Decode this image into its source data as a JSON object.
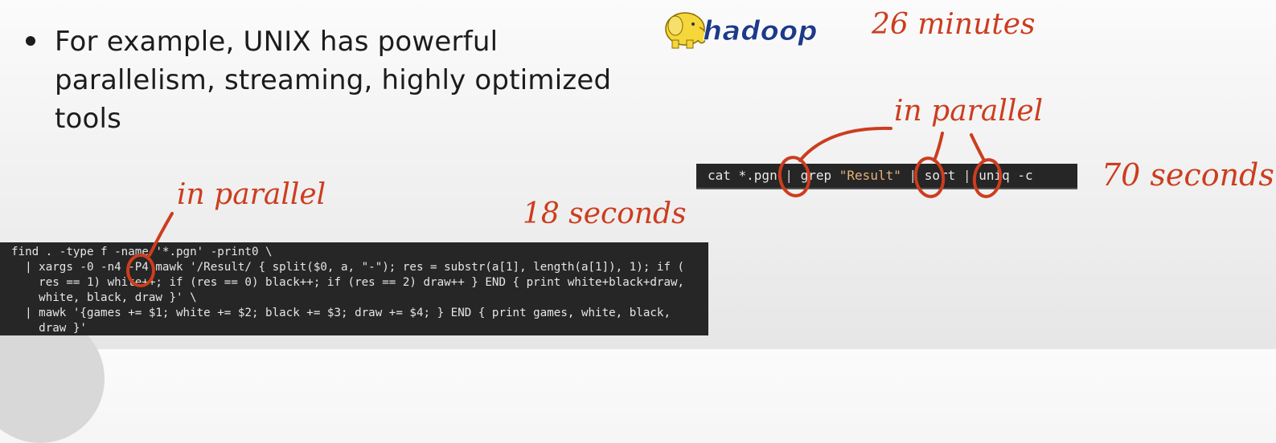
{
  "slide": {
    "bullet": "For example, UNIX has powerful parallelism, streaming, highly optimized tools"
  },
  "hadoop": {
    "logo_text": "hadoop",
    "time": "26 minutes"
  },
  "annotations": {
    "in_parallel_top": "in parallel",
    "in_parallel_bottom": "in parallel",
    "pipe_time": "70 seconds",
    "find_time": "18 seconds"
  },
  "pipeline_command": {
    "cat": "cat *.pgn",
    "sep1": " | ",
    "grep": "grep ",
    "grep_arg": "\"Result\"",
    "sep2": " | ",
    "sort": "sort",
    "sep3": " | ",
    "uniq": "uniq -c"
  },
  "find_command": {
    "lines": [
      "find . -type f -name '*.pgn' -print0 \\",
      "  | xargs -0 -n4 -P4 mawk '/Result/ { split($0, a, \"-\"); res = substr(a[1], length(a[1]), 1); if (",
      "    res == 1) white++; if (res == 0) black++; if (res == 2) draw++ } END { print white+black+draw,",
      "    white, black, draw }' \\",
      "  | mawk '{games += $1; white += $2; black += $3; draw += $4; } END { print games, white, black,",
      "    draw }'"
    ]
  },
  "colors": {
    "annotation_red": "#cc3d1e",
    "terminal_bg": "#262626",
    "text_dark": "#1c1c1c"
  }
}
